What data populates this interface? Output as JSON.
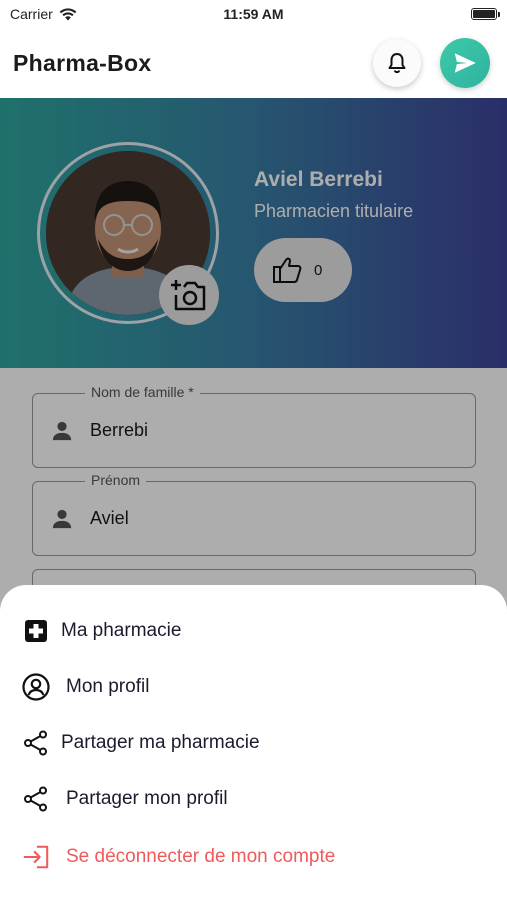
{
  "status": {
    "carrier": "Carrier",
    "time": "11:59 AM"
  },
  "app": {
    "title": "Pharma-Box"
  },
  "profile": {
    "name": "Aviel Berrebi",
    "role": "Pharmacien titulaire",
    "likes": "0"
  },
  "form": {
    "last_name": {
      "label": "Nom de famille *",
      "value": "Berrebi"
    },
    "first_name": {
      "label": "Prénom",
      "value": "Aviel"
    }
  },
  "menu": {
    "items": [
      {
        "label": "Ma pharmacie",
        "icon": "medical-cross-icon"
      },
      {
        "label": "Mon profil",
        "icon": "account-circle-icon"
      },
      {
        "label": "Partager ma pharmacie",
        "icon": "share-icon"
      },
      {
        "label": "Partager mon profil",
        "icon": "share-icon"
      },
      {
        "label": "Se déconnecter de mon compte",
        "icon": "logout-icon"
      }
    ]
  },
  "colors": {
    "banner_start": "#2fa79f",
    "banner_end": "#3f449a",
    "send_button": "#3ec9a8",
    "logout": "#ef5a5a"
  }
}
